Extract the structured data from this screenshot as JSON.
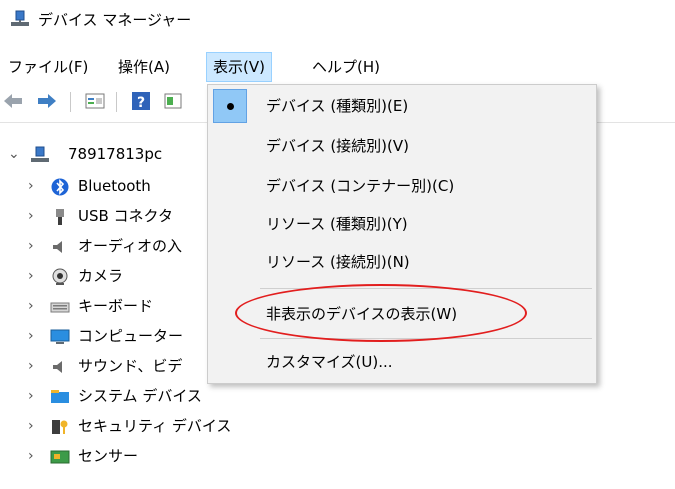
{
  "window": {
    "title": "デバイス マネージャー"
  },
  "menubar": {
    "items": [
      {
        "label": "ファイル(F)"
      },
      {
        "label": "操作(A)"
      },
      {
        "label": "表示(V)",
        "active": true
      },
      {
        "label": "ヘルプ(H)"
      }
    ]
  },
  "toolbar": {
    "buttons": [
      "back-arrow-icon",
      "forward-arrow-icon",
      "properties-icon",
      "help-icon",
      "view-icon"
    ]
  },
  "tree": {
    "root": "78917813pc",
    "items": [
      {
        "label": "Bluetooth",
        "icon": "bluetooth-icon"
      },
      {
        "label": "USB コネクタ",
        "icon": "usb-connector-icon"
      },
      {
        "label": "オーディオの入",
        "icon": "audio-icon"
      },
      {
        "label": "カメラ",
        "icon": "camera-icon"
      },
      {
        "label": "キーボード",
        "icon": "keyboard-icon"
      },
      {
        "label": "コンピューター",
        "icon": "computer-icon"
      },
      {
        "label": "サウンド、ビデ",
        "icon": "sound-icon"
      },
      {
        "label": "システム デバイス",
        "icon": "system-device-icon"
      },
      {
        "label": "セキュリティ デバイス",
        "icon": "security-device-icon"
      },
      {
        "label": "センサー",
        "icon": "sensor-icon"
      }
    ]
  },
  "view_menu": {
    "items": [
      {
        "label": "デバイス (種類別)(E)",
        "checked": true
      },
      {
        "label": "デバイス (接続別)(V)"
      },
      {
        "label": "デバイス (コンテナー別)(C)"
      },
      {
        "label": "リソース (種類別)(Y)"
      },
      {
        "label": "リソース (接続別)(N)"
      },
      {
        "label": "非表示のデバイスの表示(W)"
      },
      {
        "label": "カスタマイズ(U)..."
      }
    ]
  },
  "colors": {
    "active_menu_bg": "#cce8ff",
    "check_bg": "#90c8f6",
    "annotation_red": "#e21e1e"
  }
}
